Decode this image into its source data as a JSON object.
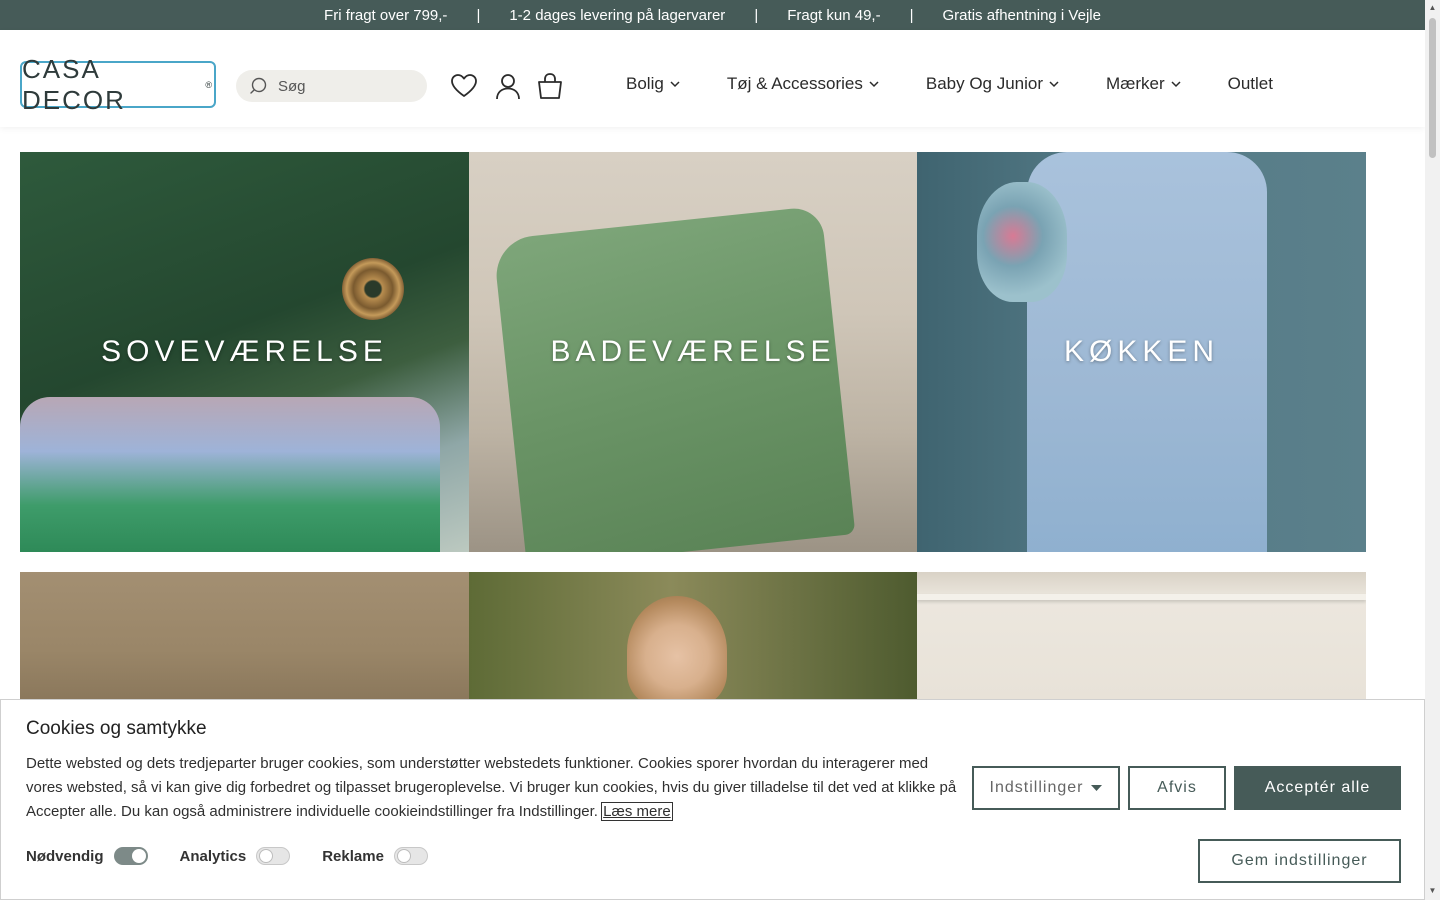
{
  "topbar": {
    "messages": [
      "Fri fragt over 799,-",
      "1-2 dages levering på lagervarer",
      "Fragt kun 49,-",
      "Gratis afhentning i Vejle"
    ],
    "separator": "|",
    "background": "#465b58"
  },
  "header": {
    "logo_text": "CASA DECOR",
    "logo_mark": "®",
    "search_placeholder": "Søg",
    "icons": [
      "heart-icon",
      "user-icon",
      "bag-icon"
    ]
  },
  "nav": [
    {
      "label": "Bolig",
      "has_dropdown": true
    },
    {
      "label": "Tøj & Accessories",
      "has_dropdown": true
    },
    {
      "label": "Baby Og Junior",
      "has_dropdown": true
    },
    {
      "label": "Mærker",
      "has_dropdown": true
    },
    {
      "label": "Outlet",
      "has_dropdown": false
    }
  ],
  "tiles": [
    {
      "label": "SOVEVÆRELSE"
    },
    {
      "label": "BADEVÆRELSE"
    },
    {
      "label": "KØKKEN"
    },
    {
      "label": ""
    },
    {
      "label": ""
    },
    {
      "label": ""
    }
  ],
  "cookie": {
    "title": "Cookies og samtykke",
    "body": "Dette websted og dets tredjeparter bruger cookies, som understøtter webstedets funktioner. Cookies sporer hvordan du interagerer med vores websted, så vi kan give dig forbedret og tilpasset brugeroplevelse. Vi bruger kun cookies, hvis du giver tilladelse til det ved at klikke på Accepter alle. Du kan også administrere individuelle cookieindstillinger fra Indstillinger.",
    "read_more": "Læs mere",
    "settings_label": "Indstillinger",
    "reject_label": "Afvis",
    "accept_label": "Acceptér alle",
    "save_label": "Gem indstillinger",
    "toggles": [
      {
        "label": "Nødvendig",
        "on": true
      },
      {
        "label": "Analytics",
        "on": false
      },
      {
        "label": "Reklame",
        "on": false
      }
    ],
    "accent": "#465b58"
  }
}
